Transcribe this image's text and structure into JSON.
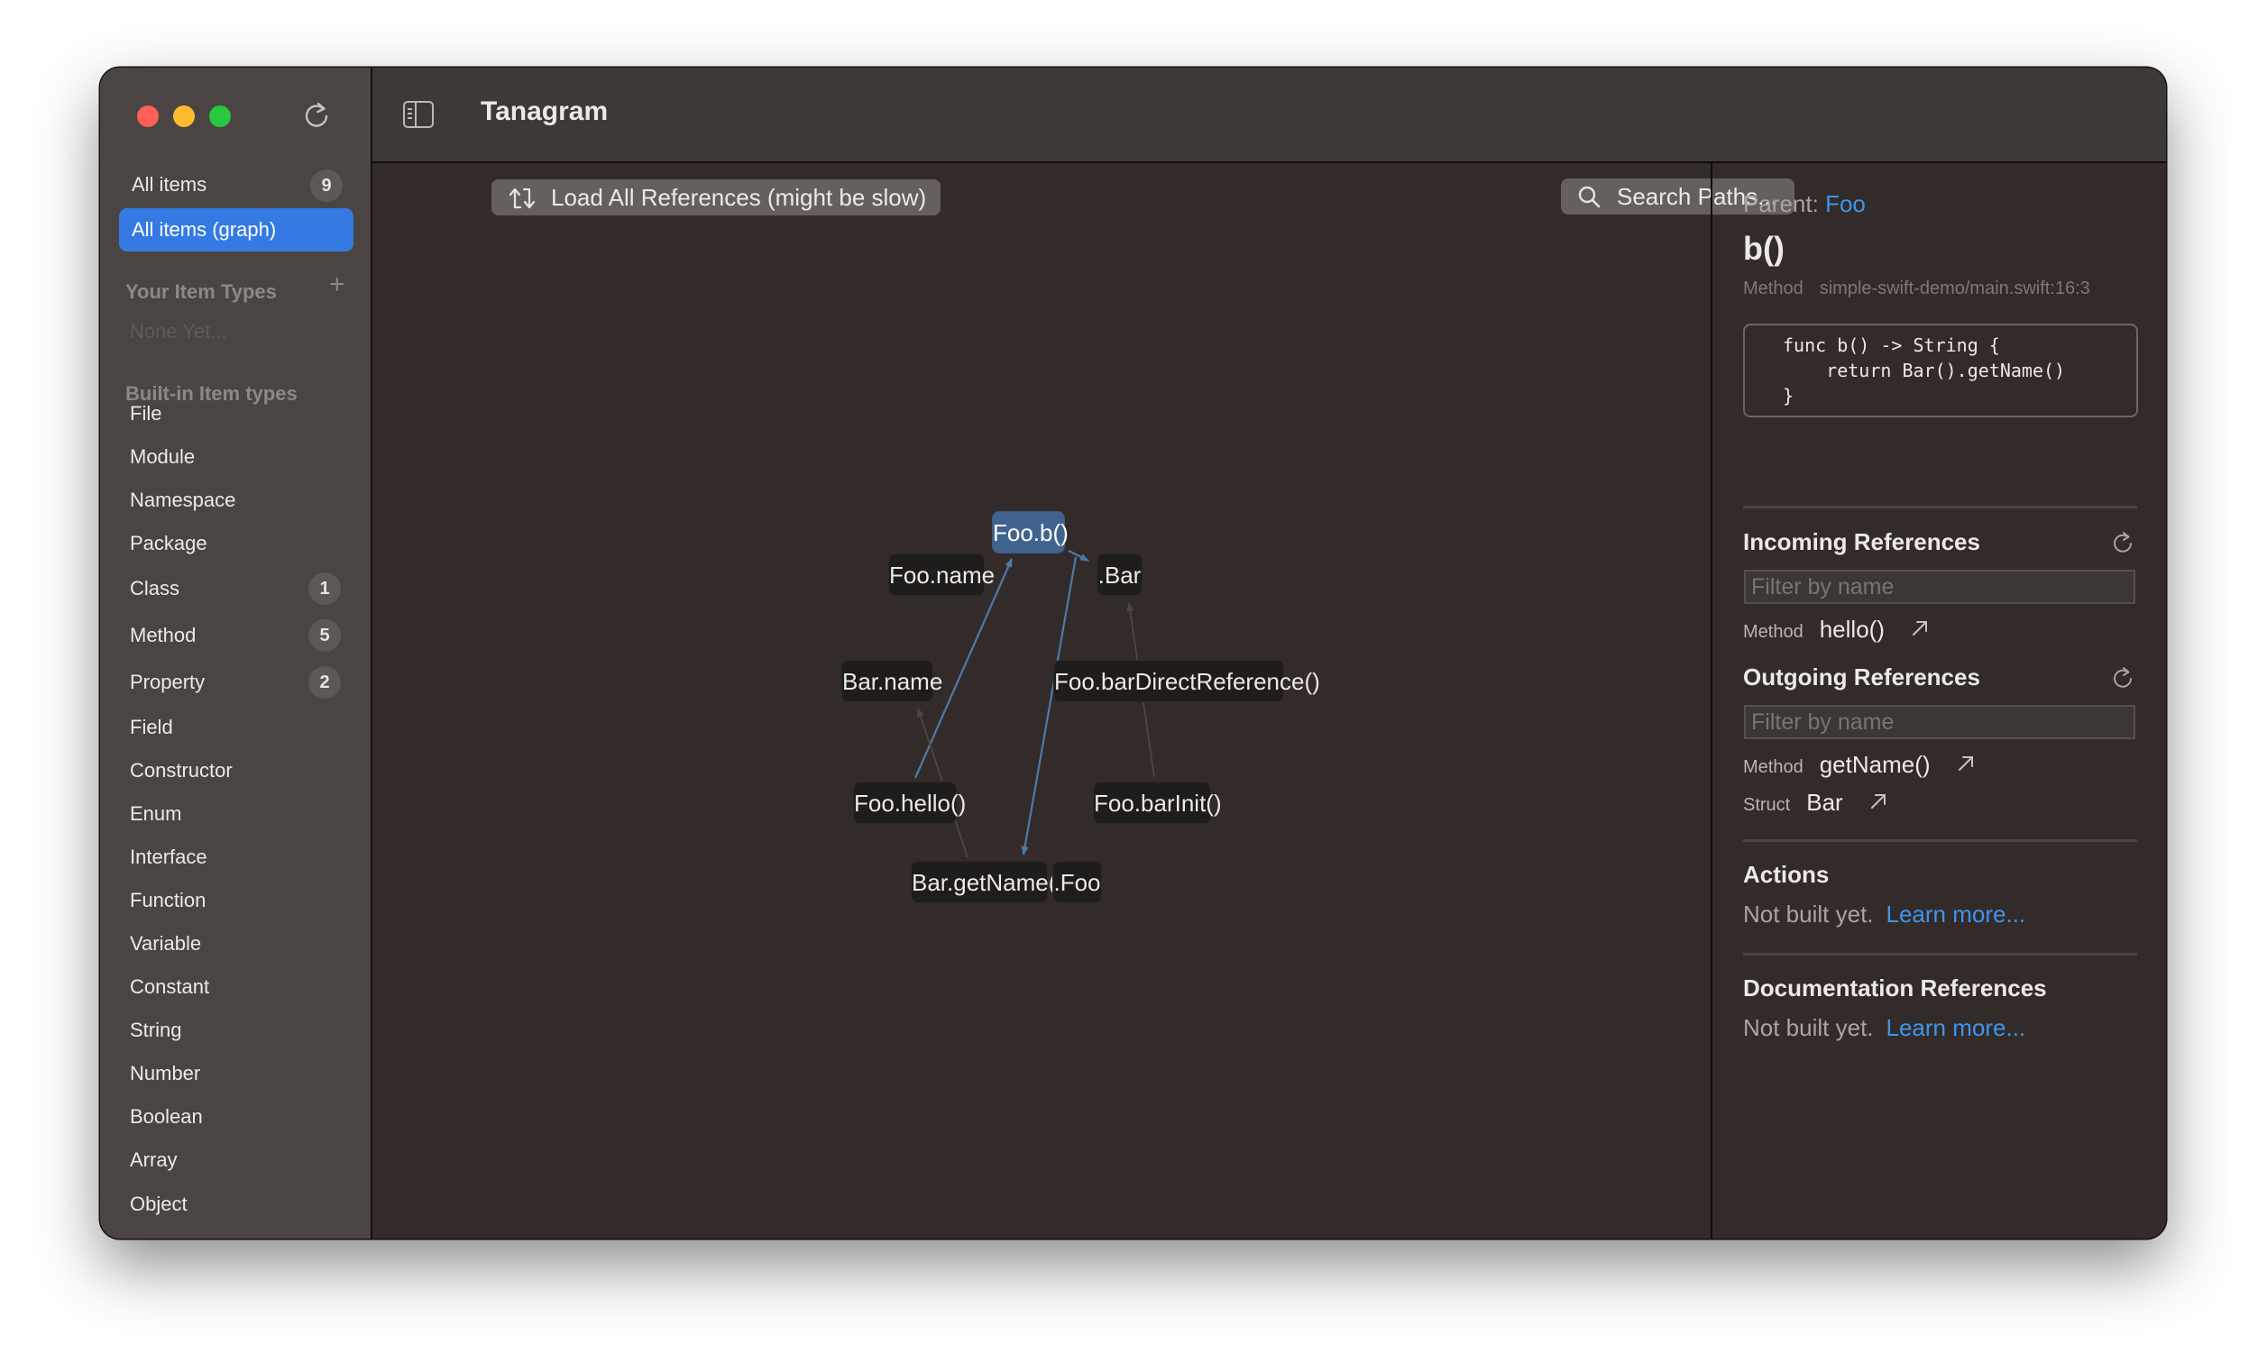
{
  "window": {
    "traffic_lights": {
      "close": "#fe5f57",
      "minimize": "#febc2e",
      "zoom": "#28c840"
    }
  },
  "sidebar": {
    "refresh_icon": "refresh-icon",
    "nav": [
      {
        "label": "All items",
        "count": "9",
        "active": false
      },
      {
        "label": "All items (graph)",
        "count": null,
        "active": true
      }
    ],
    "your_item_types": {
      "heading": "Your Item Types",
      "add_icon": "plus-icon",
      "empty_text": "None Yet..."
    },
    "builtin": {
      "heading": "Built-in Item types",
      "items": [
        {
          "label": "File",
          "count": null
        },
        {
          "label": "Module",
          "count": null
        },
        {
          "label": "Namespace",
          "count": null
        },
        {
          "label": "Package",
          "count": null
        },
        {
          "label": "Class",
          "count": "1"
        },
        {
          "label": "Method",
          "count": "5"
        },
        {
          "label": "Property",
          "count": "2"
        },
        {
          "label": "Field",
          "count": null
        },
        {
          "label": "Constructor",
          "count": null
        },
        {
          "label": "Enum",
          "count": null
        },
        {
          "label": "Interface",
          "count": null
        },
        {
          "label": "Function",
          "count": null
        },
        {
          "label": "Variable",
          "count": null
        },
        {
          "label": "Constant",
          "count": null
        },
        {
          "label": "String",
          "count": null
        },
        {
          "label": "Number",
          "count": null
        },
        {
          "label": "Boolean",
          "count": null
        },
        {
          "label": "Array",
          "count": null
        },
        {
          "label": "Object",
          "count": null
        }
      ]
    },
    "accent": "#347ae2"
  },
  "header": {
    "title": "Tanagram",
    "sidebar_toggle_icon": "sidebar-toggle-icon"
  },
  "graph": {
    "load_button": "Load All References (might be slow)",
    "search_button": "Search Paths...",
    "selected_color": "#41648e",
    "nodes": [
      {
        "id": "foo_b",
        "label": "Foo.b()",
        "selected": true
      },
      {
        "id": "foo_name",
        "label": "Foo.name",
        "selected": false
      },
      {
        "id": "bar_type",
        "label": ".Bar",
        "selected": false
      },
      {
        "id": "bar_name",
        "label": "Bar.name",
        "selected": false
      },
      {
        "id": "foo_bar_direct",
        "label": "Foo.barDirectReference()",
        "selected": false
      },
      {
        "id": "foo_hello",
        "label": "Foo.hello()",
        "selected": false
      },
      {
        "id": "foo_bar_init",
        "label": "Foo.barInit()",
        "selected": false
      },
      {
        "id": "bar_get_name",
        "label": "Bar.getName()",
        "selected": false
      },
      {
        "id": "foo_type",
        "label": ".Foo",
        "selected": false
      }
    ],
    "edges": [
      {
        "from": "foo_hello",
        "to": "foo_b",
        "highlighted": true
      },
      {
        "from": "foo_b",
        "to": "bar_get_name",
        "highlighted": true
      },
      {
        "from": "foo_b",
        "to": "bar_type",
        "highlighted": true
      },
      {
        "from": "bar_get_name",
        "to": "bar_name",
        "highlighted": false
      },
      {
        "from": "foo_bar_init",
        "to": "bar_type",
        "highlighted": false
      }
    ]
  },
  "details": {
    "parent_label": "Parent:",
    "parent_name": "Foo",
    "title": "b()",
    "kind": "Method",
    "location": "simple-swift-demo/main.swift:16:3",
    "code": "func b() -> String {\n    return Bar().getName()\n}",
    "incoming": {
      "heading": "Incoming References",
      "filter_placeholder": "Filter by name",
      "items": [
        {
          "kind": "Method",
          "name": "hello()"
        }
      ]
    },
    "outgoing": {
      "heading": "Outgoing References",
      "filter_placeholder": "Filter by name",
      "items": [
        {
          "kind": "Method",
          "name": "getName()"
        },
        {
          "kind": "Struct",
          "name": "Bar"
        }
      ]
    },
    "actions": {
      "heading": "Actions",
      "text": "Not built yet.",
      "link": "Learn more..."
    },
    "documentation": {
      "heading": "Documentation References",
      "text": "Not built yet.",
      "link": "Learn more..."
    },
    "link_color": "#3d95ee"
  }
}
